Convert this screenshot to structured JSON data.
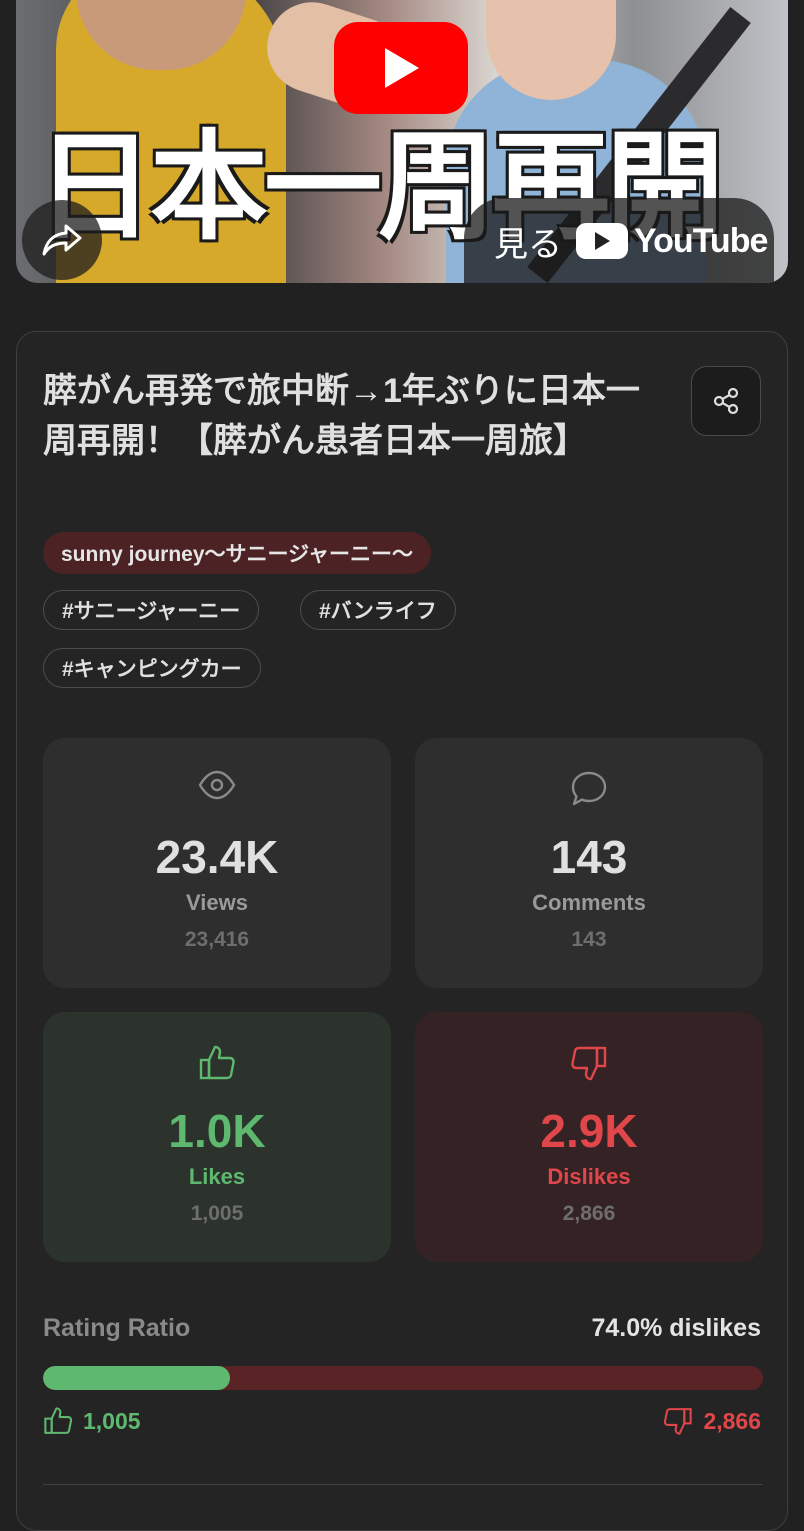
{
  "thumbnail": {
    "overlay_title": "日本一周再開",
    "watch_label": "見る",
    "youtube_word": "YouTube"
  },
  "video": {
    "title": "膵がん再発で旅中断→1年ぶりに日本一周再開！【膵がん患者日本一周旅】",
    "channel": "sunny journey〜サニージャーニー〜",
    "tags": [
      "#サニージャーニー",
      "#バンライフ",
      "#キャンピングカー"
    ]
  },
  "stats": {
    "views": {
      "big": "23.4K",
      "label": "Views",
      "exact": "23,416",
      "icon": "eye-icon"
    },
    "comments": {
      "big": "143",
      "label": "Comments",
      "exact": "143",
      "icon": "comment-icon"
    },
    "likes": {
      "big": "1.0K",
      "label": "Likes",
      "exact": "1,005",
      "icon": "thumbs-up-icon"
    },
    "dislikes": {
      "big": "2.9K",
      "label": "Dislikes",
      "exact": "2,866",
      "icon": "thumbs-down-icon"
    }
  },
  "rating": {
    "label": "Rating Ratio",
    "value_text": "74.0% dislikes",
    "like_fraction": 0.26,
    "likes": "1,005",
    "dislikes": "2,866"
  },
  "colors": {
    "like": "#5fb86f",
    "dislike": "#e0464a",
    "channel_chip": "#4d2224",
    "youtube_red": "#ff0000"
  }
}
